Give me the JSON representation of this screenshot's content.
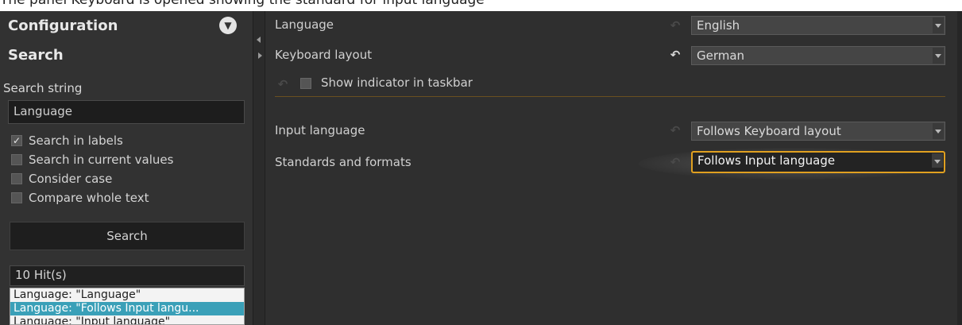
{
  "caption": "The panel Keyboard is opened showing the standard for input language",
  "sidebar": {
    "configuration_label": "Configuration",
    "search_heading": "Search",
    "search_string_label": "Search string",
    "search_value": "Language",
    "checkboxes": [
      {
        "label": "Search in labels",
        "checked": true
      },
      {
        "label": "Search in current values",
        "checked": false
      },
      {
        "label": "Consider case",
        "checked": false
      },
      {
        "label": "Compare whole text",
        "checked": false
      }
    ],
    "search_button": "Search",
    "hits": "10 Hit(s)",
    "results": [
      "Language: \"Language\"",
      "Language: \"Follows Input langu...",
      "Language: \"Input language\""
    ]
  },
  "main": {
    "rows": [
      {
        "label": "Language",
        "value": "English"
      },
      {
        "label": "Keyboard layout",
        "value": "German"
      },
      {
        "label": "Show indicator in taskbar"
      },
      {
        "label": "Input language",
        "value": "Follows Keyboard layout"
      },
      {
        "label": "Standards and formats",
        "value": "Follows Input language"
      }
    ]
  },
  "colors": {
    "accent": "#e0a020",
    "selection": "#3aa0b8"
  }
}
